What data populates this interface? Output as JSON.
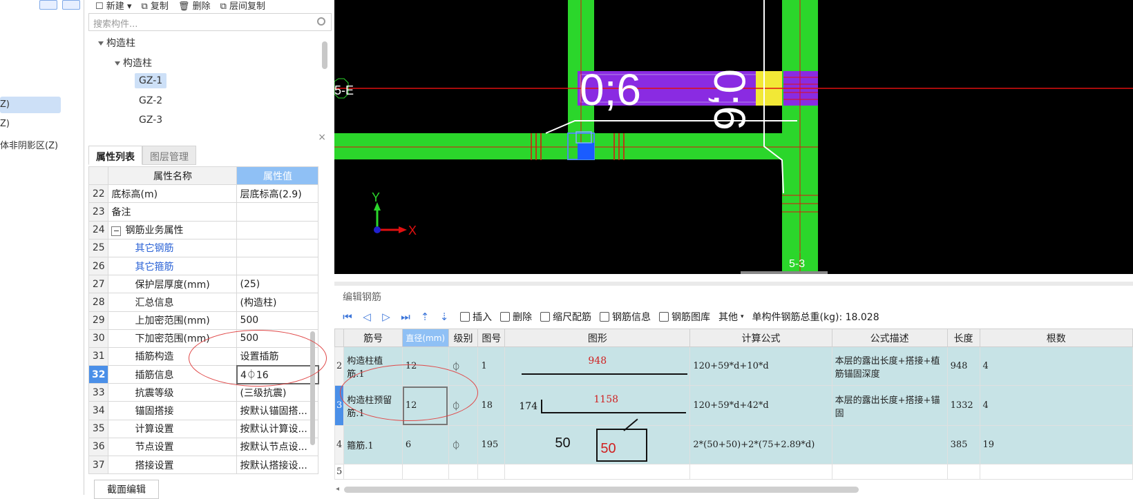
{
  "left_strip": {
    "items": [
      "Z)",
      "Z)",
      "体非阴影区(Z)"
    ]
  },
  "component_panel": {
    "toolbar": {
      "new": "新建",
      "copy": "复制",
      "delete": "删除",
      "floor_copy": "层间复制"
    },
    "search_placeholder": "搜索构件...",
    "tree": {
      "root": "构造柱",
      "child": "构造柱",
      "items": [
        "GZ-1",
        "GZ-2",
        "GZ-3"
      ]
    }
  },
  "properties": {
    "tabs": [
      "属性列表",
      "图层管理"
    ],
    "header": {
      "name": "属性名称",
      "value": "属性值"
    },
    "rows": [
      {
        "num": "22",
        "name": "底标高(m)",
        "value": "层底标高(2.9)"
      },
      {
        "num": "23",
        "name": "备注",
        "value": ""
      },
      {
        "num": "24",
        "name": "钢筋业务属性",
        "value": ""
      },
      {
        "num": "25",
        "name": "其它钢筋",
        "value": ""
      },
      {
        "num": "26",
        "name": "其它箍筋",
        "value": ""
      },
      {
        "num": "27",
        "name": "保护层厚度(mm)",
        "value": "(25)"
      },
      {
        "num": "28",
        "name": "汇总信息",
        "value": "(构造柱)"
      },
      {
        "num": "29",
        "name": "上加密范围(mm)",
        "value": "500"
      },
      {
        "num": "30",
        "name": "下加密范围(mm)",
        "value": "500"
      },
      {
        "num": "31",
        "name": "插筋构造",
        "value": "设置插筋"
      },
      {
        "num": "32",
        "name": "插筋信息",
        "value": "4⏀16"
      },
      {
        "num": "33",
        "name": "抗震等级",
        "value": "(三级抗震)"
      },
      {
        "num": "34",
        "name": "锚固搭接",
        "value": "按默认锚固搭..."
      },
      {
        "num": "35",
        "name": "计算设置",
        "value": "按默认计算设..."
      },
      {
        "num": "36",
        "name": "节点设置",
        "value": "按默认节点设..."
      },
      {
        "num": "37",
        "name": "搭接设置",
        "value": "按默认搭接设..."
      }
    ],
    "section_edit_button": "截面编辑"
  },
  "cad": {
    "axis_labels": [
      "5-E",
      "5-3"
    ],
    "dim_texts": [
      "0;6",
      "0;6"
    ],
    "axis_x": "X",
    "axis_y": "Y"
  },
  "rebar_editor": {
    "title": "编辑钢筋",
    "toolbar": {
      "insert": "插入",
      "delete": "删除",
      "scale": "缩尺配筋",
      "info": "钢筋信息",
      "library": "钢筋图库",
      "other": "其他",
      "total_weight": "单构件钢筋总重(kg): 18.028"
    },
    "columns": [
      "筋号",
      "直径(mm)",
      "级别",
      "图号",
      "图形",
      "计算公式",
      "公式描述",
      "长度",
      "根数"
    ],
    "rows": [
      {
        "row": "2",
        "name": "构造柱植筋.1",
        "dia": "12",
        "grade": "⏀",
        "fig": "1",
        "shape_label": "948",
        "shape_side": "",
        "formula": "120+59*d+10*d",
        "desc": "本层的露出长度+搭接+植筋锚固深度",
        "length": "948",
        "count": "4"
      },
      {
        "row": "3",
        "name": "构造柱预留筋.1",
        "dia": "12",
        "grade": "⏀",
        "fig": "18",
        "shape_label": "1158",
        "shape_side": "174",
        "formula": "120+59*d+42*d",
        "desc": "本层的露出长度+搭接+锚固",
        "length": "1332",
        "count": "4"
      },
      {
        "row": "4",
        "name": "箍筋.1",
        "dia": "6",
        "grade": "⏀",
        "fig": "195",
        "shape_label": "50",
        "shape_side": "50",
        "formula": "2*(50+50)+2*(75+2.89*d)",
        "desc": "",
        "length": "385",
        "count": "19"
      }
    ],
    "empty_row": "5"
  },
  "colors": {
    "accent": "#4a8fe8",
    "cad_green": "#2bd62b",
    "cad_purple": "#8a2be2",
    "cad_yellow": "#f2e836",
    "cad_red": "#e01010",
    "row_teal": "#c7e3e6",
    "annotation_red": "#e04848"
  }
}
